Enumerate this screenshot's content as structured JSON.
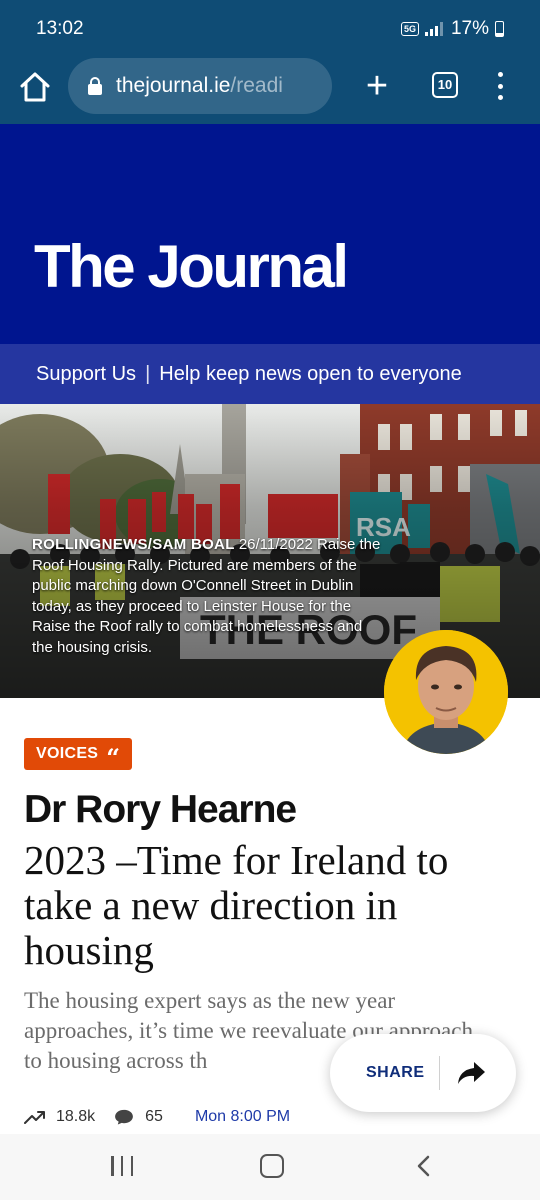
{
  "status_bar": {
    "time": "13:02",
    "network": "5G",
    "battery": "17%",
    "text_color": "#ffffff"
  },
  "browser": {
    "url_host": "thejournal.ie",
    "url_path": "/readi",
    "tab_count": "10",
    "toolbar_color": "#0f4c75",
    "icons": [
      "home-icon",
      "lock-icon",
      "new-tab-icon",
      "tabs-icon",
      "more-menu-icon"
    ]
  },
  "site": {
    "logo": "The Journal",
    "masthead_color": "#00158f",
    "support_link": "Support Us",
    "support_separator": "|",
    "support_tagline": "Help keep news open to everyone"
  },
  "hero": {
    "credit": "ROLLINGNEWS/SAM BOAL",
    "date": "26/11/2022",
    "caption": "Raise the Roof Housing Rally. Pictured are members of the public marching down O'Connell Street in Dublin today, as they proceed to Leinster House for the Raise the Roof rally to combat homelessness and the housing crisis."
  },
  "article": {
    "section": "VOICES",
    "section_icon": "quote-icon",
    "section_color": "#e14a07",
    "author": "Dr Rory Hearne",
    "headline": "2023 –Time for Ireland to take a new direction in housing",
    "standfirst": "The housing expert says as the new year approaches, it’s time we reevaluate our approach to housing across th",
    "views": "18.8k",
    "comments": "65",
    "published": "Mon 8:00 PM",
    "share_label": "SHARE"
  },
  "nav": {
    "icons": [
      "recent-apps-icon",
      "home-button-icon",
      "back-icon"
    ]
  }
}
